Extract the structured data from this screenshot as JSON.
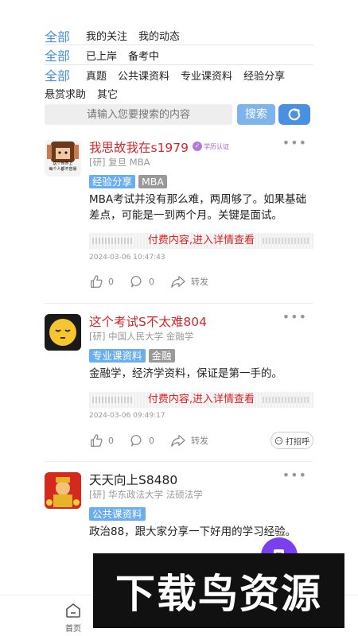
{
  "filters": {
    "row1": {
      "all": "全部",
      "options": [
        "我的关注",
        "我的动态"
      ]
    },
    "row2": {
      "all": "全部",
      "options": [
        "已上岸",
        "备考中"
      ]
    },
    "row3": {
      "all": "全部",
      "options": [
        "真题",
        "公共课资料",
        "专业课资料",
        "经验分享"
      ]
    },
    "row3_more": [
      "悬赏求助",
      "其它"
    ]
  },
  "search": {
    "placeholder": "请输入您要搜索的内容",
    "button": "搜索"
  },
  "posts": [
    {
      "username": "我思故我在s1979",
      "verified_label": "学历认证",
      "school": "[研] 复旦 MBA",
      "tags": [
        "经验分享",
        "MBA"
      ],
      "content": "MBA考试并没有那么难，两周够了。如果基础差点，可能是一到两个月。关键是面试。",
      "paid_text": "付费内容,进入详情查看",
      "date": "2024-03-06 10:47:43",
      "likes": "0",
      "comments": "0",
      "share_label": "转发"
    },
    {
      "username": "这个考试S不太难804",
      "school": "[研] 中国人民大学 金融学",
      "tags": [
        "专业课资料",
        "金融"
      ],
      "content": "金融学，经济学资料，保证是第一手的。",
      "paid_text": "付费内容,进入详情查看",
      "date": "2024-03-06 09:49:17",
      "likes": "0",
      "comments": "0",
      "share_label": "转发",
      "greet_label": "打招呼"
    },
    {
      "username": "天天向上S8480",
      "school": "[研] 华东政法大学 法硕法学",
      "tags": [
        "公共课资料"
      ],
      "content": "政治88，跟大家分享一下好用的学习经验。"
    }
  ],
  "avatar_caption": [
    "这个世界上",
    "每个人都不容易"
  ],
  "nav": {
    "home": "首页"
  },
  "watermark": "下载鸟资源",
  "colors": {
    "accent": "#4a90e2",
    "red": "#d7262a",
    "purple": "#7b3ff2"
  }
}
